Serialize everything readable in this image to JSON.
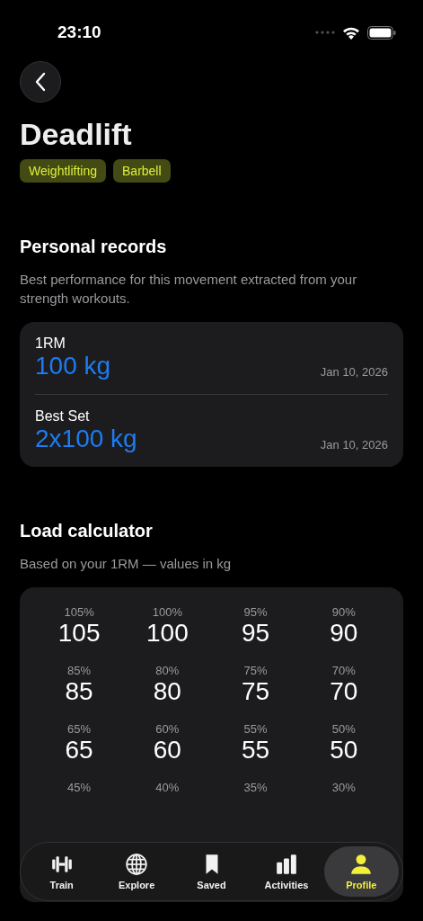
{
  "status_bar": {
    "time": "23:10"
  },
  "title": "Deadlift",
  "tags": [
    "Weightlifting",
    "Barbell"
  ],
  "personal_records": {
    "heading": "Personal records",
    "description": "Best performance for this movement extracted from your strength workouts.",
    "records": [
      {
        "label": "1RM",
        "value": "100 kg",
        "date": "Jan 10, 2026"
      },
      {
        "label": "Best Set",
        "value": "2x100 kg",
        "date": "Jan 10, 2026"
      }
    ]
  },
  "load_calculator": {
    "heading": "Load calculator",
    "description": "Based on your 1RM — values in kg",
    "cells": [
      {
        "percent": "105%",
        "value": "105"
      },
      {
        "percent": "100%",
        "value": "100"
      },
      {
        "percent": "95%",
        "value": "95"
      },
      {
        "percent": "90%",
        "value": "90"
      },
      {
        "percent": "85%",
        "value": "85"
      },
      {
        "percent": "80%",
        "value": "80"
      },
      {
        "percent": "75%",
        "value": "75"
      },
      {
        "percent": "70%",
        "value": "70"
      },
      {
        "percent": "65%",
        "value": "65"
      },
      {
        "percent": "60%",
        "value": "60"
      },
      {
        "percent": "55%",
        "value": "55"
      },
      {
        "percent": "50%",
        "value": "50"
      },
      {
        "percent": "45%"
      },
      {
        "percent": "40%"
      },
      {
        "percent": "35%"
      },
      {
        "percent": "30%"
      }
    ]
  },
  "tab_bar": [
    {
      "label": "Train",
      "selected": false
    },
    {
      "label": "Explore",
      "selected": false
    },
    {
      "label": "Saved",
      "selected": false
    },
    {
      "label": "Activities",
      "selected": false
    },
    {
      "label": "Profile",
      "selected": true
    }
  ]
}
